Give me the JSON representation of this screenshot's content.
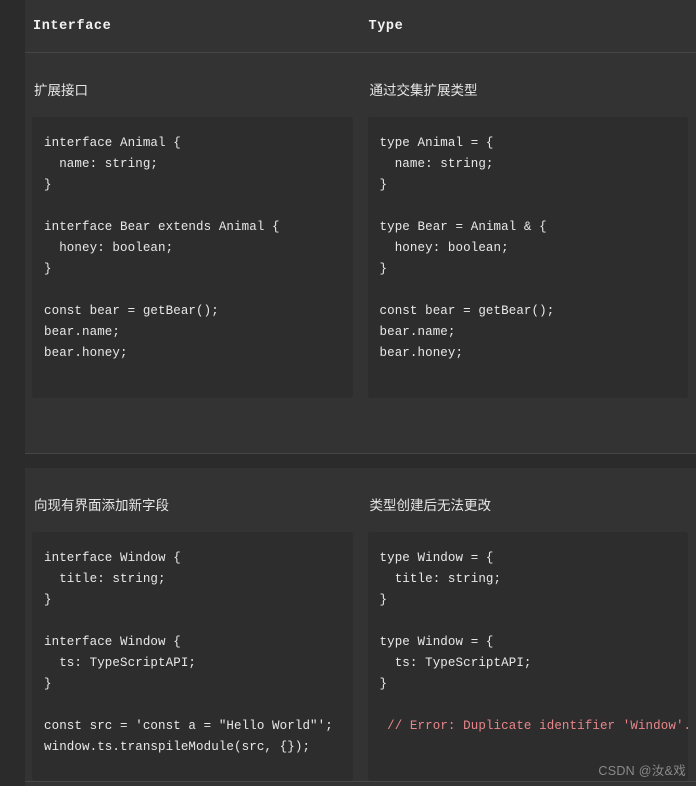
{
  "table": {
    "columns": [
      {
        "header": "Interface"
      },
      {
        "header": "Type"
      }
    ],
    "rows": [
      {
        "cells": [
          {
            "subtitle": "扩展接口",
            "code": "interface Animal {\n  name: string;\n}\n\ninterface Bear extends Animal {\n  honey: boolean;\n}\n\nconst bear = getBear();\nbear.name;\nbear.honey;"
          },
          {
            "subtitle": "通过交集扩展类型",
            "code": "type Animal = {\n  name: string;\n}\n\ntype Bear = Animal & {\n  honey: boolean;\n}\n\nconst bear = getBear();\nbear.name;\nbear.honey;"
          }
        ]
      },
      {
        "cells": [
          {
            "subtitle": "向现有界面添加新字段",
            "code": "interface Window {\n  title: string;\n}\n\ninterface Window {\n  ts: TypeScriptAPI;\n}\n\nconst src = 'const a = \"Hello World\"';\nwindow.ts.transpileModule(src, {});"
          },
          {
            "subtitle": "类型创建后无法更改",
            "code_before": "type Window = {\n  title: string;\n}\n\ntype Window = {\n  ts: TypeScriptAPI;\n}\n\n ",
            "code_error": "// Error: Duplicate identifier 'Window'."
          }
        ]
      }
    ]
  },
  "watermark": "CSDN @汝&戏",
  "colors": {
    "page_background": "#2b2b2b",
    "table_background": "#333333",
    "code_background": "#2d2d2d",
    "divider": "#444748",
    "text": "#e8e8e8",
    "error_text": "#e8868a",
    "watermark_text": "#8a8a8a"
  }
}
